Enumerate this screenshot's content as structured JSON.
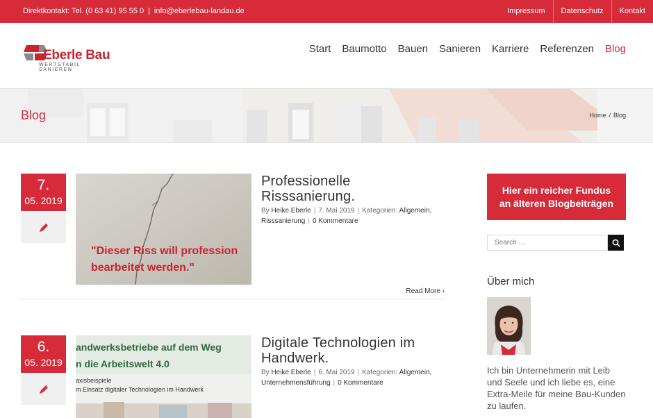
{
  "topbar": {
    "contact": "Direktkontakt: Tel. (0 63 41) 95 55 0",
    "email": "info@eberlebau-landau.de",
    "links": [
      "Impressum",
      "Datenschutz",
      "Kontakt"
    ]
  },
  "logo": {
    "name": "Eberle Bau",
    "tagline": "WERTSTABIL SANIEREN"
  },
  "nav": {
    "items": [
      "Start",
      "Baumotto",
      "Bauen",
      "Sanieren",
      "Karriere",
      "Referenzen",
      "Blog"
    ],
    "active": "Blog"
  },
  "page": {
    "title": "Blog",
    "breadcrumb": [
      "Home",
      "Blog"
    ]
  },
  "posts": [
    {
      "day": "7.",
      "month": "05. 2019",
      "title_line1": "Professionelle",
      "title_line2": "Risssanierung.",
      "by": "By",
      "author": "Heike Eberle",
      "date": "7. Mai 2019",
      "categories_label": "Kategorien:",
      "categories": [
        "Allgemein,",
        "Risssanierung"
      ],
      "comments": "0 Kommentare",
      "read_more": "Read More",
      "image_text_line1": "\"Dieser Riss will profession",
      "image_text_line2": "bearbeitet werden.\""
    },
    {
      "day": "6.",
      "month": "05. 2019",
      "title_line1": "Digitale Technologien im",
      "title_line2": "Handwerk.",
      "by": "By",
      "author": "Heike Eberle",
      "date": "6. Mai 2019",
      "categories_label": "Kategorien:",
      "categories": [
        "Allgemein,",
        "Unternehmensführung"
      ],
      "comments": "0 Kommentare",
      "image_text_line1": "andwerksbetriebe auf dem Weg",
      "image_text_line2": "n die Arbeitswelt 4.0",
      "image_text_line3": "axisbeispiele",
      "image_text_line4": "m Einsatz digitaler Technologien im Handwerk"
    }
  ],
  "sidebar": {
    "banner_line1": "Hier ein reicher Fundus",
    "banner_line2": "an älteren Blogbeiträgen",
    "search_placeholder": "Search ...",
    "about_heading": "Über mich",
    "about_text": "Ich bin Unternehmerin mit Leib und Seele und ich liebe es, eine Extra-Meile für meine Bau-Kunden zu laufen."
  },
  "colors": {
    "brand_red": "#d72b3a",
    "dark": "#333333"
  }
}
